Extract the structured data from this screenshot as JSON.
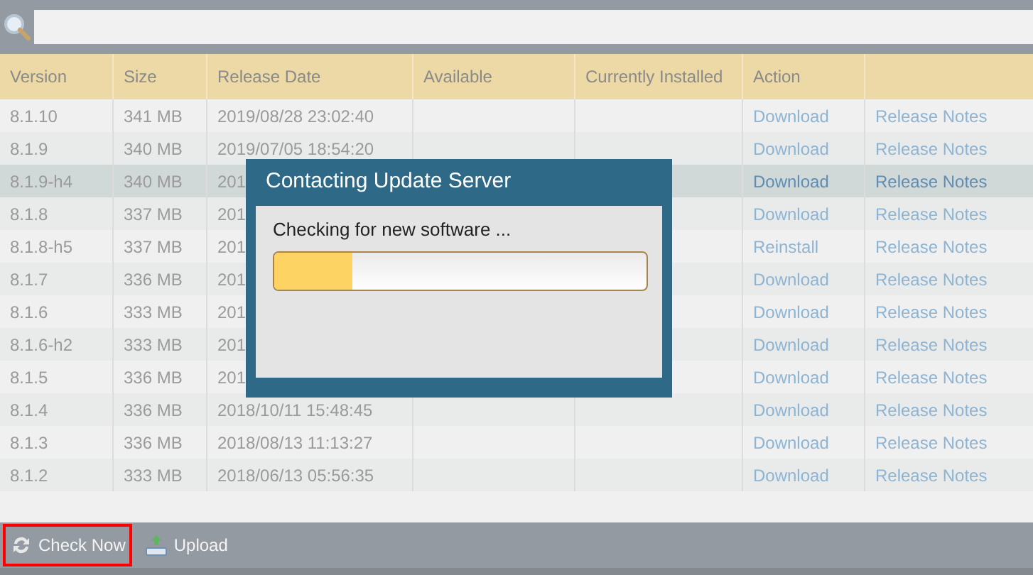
{
  "table": {
    "columns": [
      "Version",
      "Size",
      "Release Date",
      "Available",
      "Currently Installed",
      "Action"
    ],
    "rows": [
      {
        "version": "8.1.10",
        "size": "341 MB",
        "release_date": "2019/08/28 23:02:40",
        "action": "Download",
        "notes": "Release Notes",
        "selected": false
      },
      {
        "version": "8.1.9",
        "size": "340 MB",
        "release_date": "2019/07/05 18:54:20",
        "action": "Download",
        "notes": "Release Notes",
        "selected": false
      },
      {
        "version": "8.1.9-h4",
        "size": "340 MB",
        "release_date": "201",
        "action": "Download",
        "notes": "Release Notes",
        "selected": true
      },
      {
        "version": "8.1.8",
        "size": "337 MB",
        "release_date": "201",
        "action": "Download",
        "notes": "Release Notes",
        "selected": false
      },
      {
        "version": "8.1.8-h5",
        "size": "337 MB",
        "release_date": "201",
        "action": "Reinstall",
        "notes": "Release Notes",
        "selected": false
      },
      {
        "version": "8.1.7",
        "size": "336 MB",
        "release_date": "201",
        "action": "Download",
        "notes": "Release Notes",
        "selected": false
      },
      {
        "version": "8.1.6",
        "size": "333 MB",
        "release_date": "201",
        "action": "Download",
        "notes": "Release Notes",
        "selected": false
      },
      {
        "version": "8.1.6-h2",
        "size": "333 MB",
        "release_date": "201",
        "action": "Download",
        "notes": "Release Notes",
        "selected": false
      },
      {
        "version": "8.1.5",
        "size": "336 MB",
        "release_date": "201",
        "action": "Download",
        "notes": "Release Notes",
        "selected": false
      },
      {
        "version": "8.1.4",
        "size": "336 MB",
        "release_date": "2018/10/11 15:48:45",
        "action": "Download",
        "notes": "Release Notes",
        "selected": false
      },
      {
        "version": "8.1.3",
        "size": "336 MB",
        "release_date": "2018/08/13 11:13:27",
        "action": "Download",
        "notes": "Release Notes",
        "selected": false
      },
      {
        "version": "8.1.2",
        "size": "333 MB",
        "release_date": "2018/06/13 05:56:35",
        "action": "Download",
        "notes": "Release Notes",
        "selected": false
      }
    ]
  },
  "dialog": {
    "title": "Contacting Update Server",
    "message": "Checking for new software ...",
    "level": 0.21
  },
  "toolbar": [
    {
      "label": "Check Now",
      "kind": "refresh",
      "highlighted": true
    },
    {
      "label": "Upload",
      "kind": "upload",
      "highlighted": false
    }
  ]
}
